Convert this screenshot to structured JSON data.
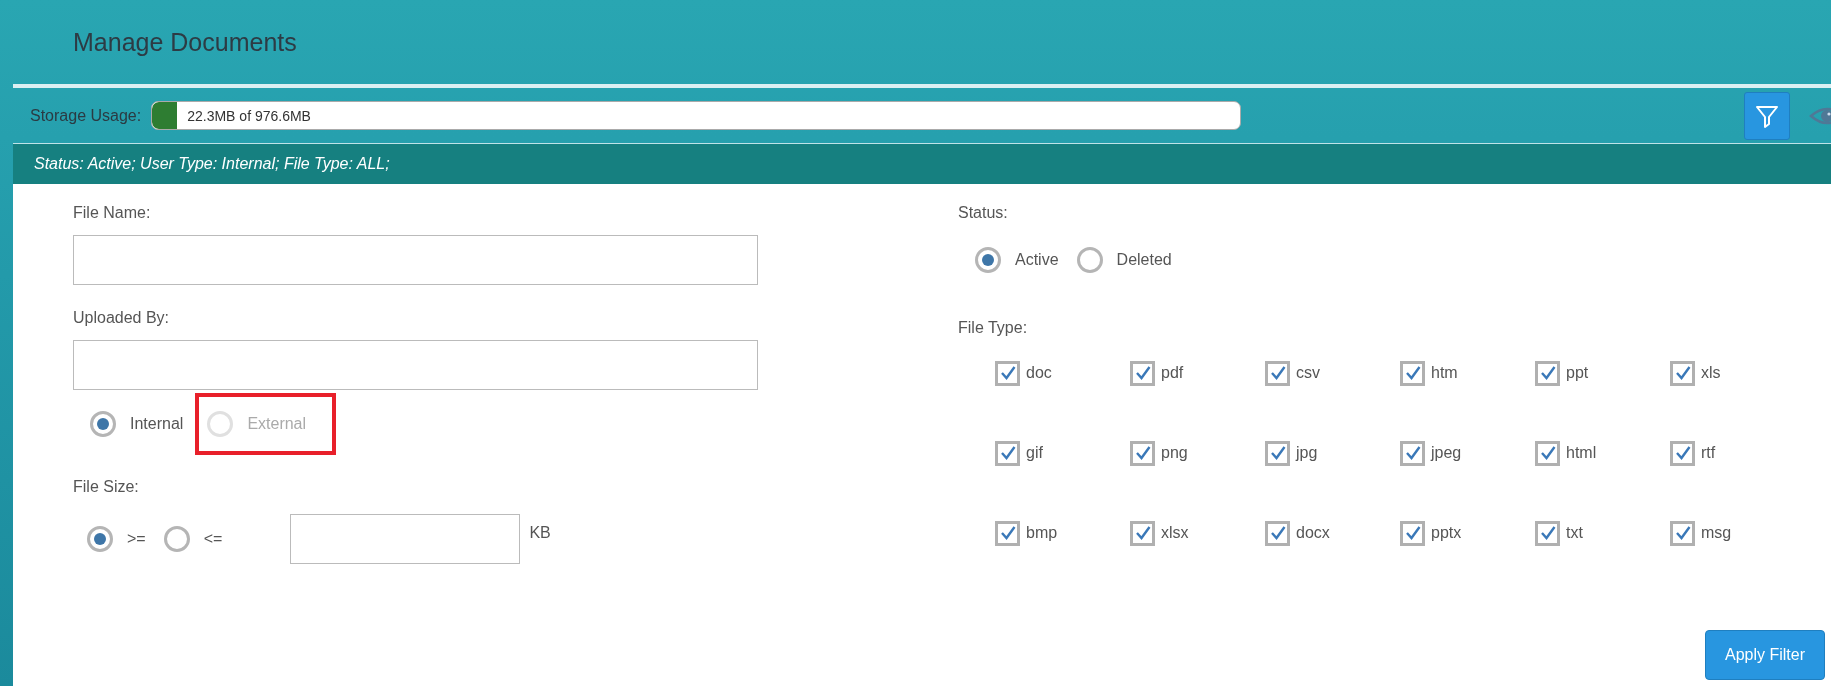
{
  "header": {
    "title": "Manage Documents"
  },
  "storage": {
    "label": "Storage Usage:",
    "level": 0.023,
    "reading": "22.3MB of 976.6MB"
  },
  "filter_summary": "Status: Active; User Type: Internal; File Type: ALL;",
  "form": {
    "file_name": {
      "label": "File Name:"
    },
    "uploaded_by": {
      "label": "Uploaded By:",
      "user_types": [
        {
          "label": "Internal",
          "selected": true,
          "disabled": false,
          "highlighted": false
        },
        {
          "label": "External",
          "selected": false,
          "disabled": true,
          "highlighted": true
        }
      ]
    },
    "file_size": {
      "label": "File Size:",
      "operators": [
        {
          "label": ">=",
          "selected": true
        },
        {
          "label": "<=",
          "selected": false
        }
      ],
      "unit": "KB"
    },
    "status": {
      "label": "Status:",
      "options": [
        {
          "label": "Active",
          "selected": true
        },
        {
          "label": "Deleted",
          "selected": false
        }
      ]
    },
    "file_type": {
      "label": "File Type:",
      "types": [
        {
          "label": "doc",
          "checked": true
        },
        {
          "label": "pdf",
          "checked": true
        },
        {
          "label": "csv",
          "checked": true
        },
        {
          "label": "htm",
          "checked": true
        },
        {
          "label": "ppt",
          "checked": true
        },
        {
          "label": "xls",
          "checked": true
        },
        {
          "label": "gif",
          "checked": true
        },
        {
          "label": "png",
          "checked": true
        },
        {
          "label": "jpg",
          "checked": true
        },
        {
          "label": "jpeg",
          "checked": true
        },
        {
          "label": "html",
          "checked": true
        },
        {
          "label": "rtf",
          "checked": true
        },
        {
          "label": "bmp",
          "checked": true
        },
        {
          "label": "xlsx",
          "checked": true
        },
        {
          "label": "docx",
          "checked": true
        },
        {
          "label": "pptx",
          "checked": true
        },
        {
          "label": "txt",
          "checked": true
        },
        {
          "label": "msg",
          "checked": true
        }
      ]
    }
  },
  "apply_button": "Apply Filter"
}
